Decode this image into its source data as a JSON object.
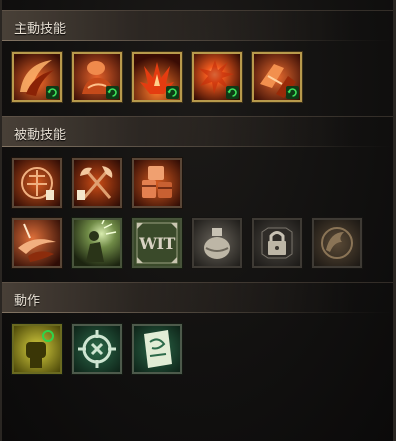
{
  "sections": {
    "active": {
      "title": "主動技能"
    },
    "passive": {
      "title": "被動技能"
    },
    "actions": {
      "title": "動作"
    }
  },
  "slots": {
    "wit_label": "WIT"
  },
  "icons": {
    "active": [
      "slash-arc-icon",
      "flexing-arm-icon",
      "flame-burst-icon",
      "explosion-icon",
      "shield-strike-icon"
    ],
    "passive_row1": [
      "armor-emblem-icon",
      "crossed-axes-icon",
      "siege-barrel-icon"
    ],
    "passive_row2": [
      "sword-sweep-icon",
      "figure-aura-icon",
      "wit-stat-icon",
      "potion-flask-icon",
      "locked-padlock-icon",
      "bird-emblem-icon"
    ],
    "actions": [
      "green-fist-icon",
      "target-cancel-icon",
      "scroll-icon"
    ]
  },
  "colors": {
    "active_border": "#b89a4c",
    "cooldown_badge": "#2fd44a",
    "passive_fire": "#c83a10",
    "action_green": "#3b7a4c"
  }
}
